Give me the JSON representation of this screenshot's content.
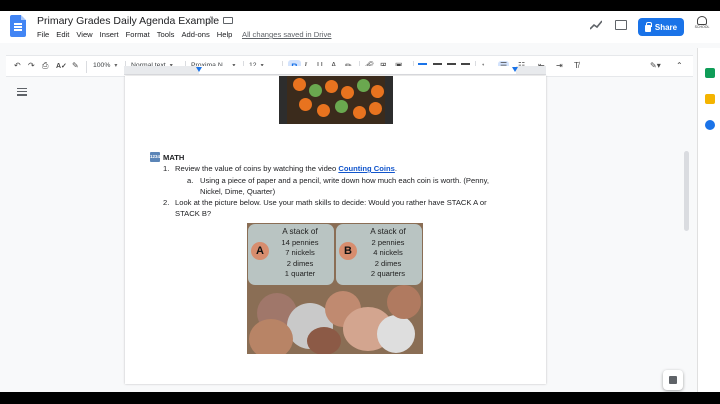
{
  "app": {
    "doc_title": "Primary Grades Daily Agenda Example",
    "save_status": "All changes saved in Drive",
    "menu": [
      "File",
      "Edit",
      "View",
      "Insert",
      "Format",
      "Tools",
      "Add-ons",
      "Help"
    ],
    "share_label": "Share",
    "avatar_text": "SCHOOL"
  },
  "toolbar": {
    "zoom": "100%",
    "style": "Normal text",
    "font": "Proxima N...",
    "font_size": "12"
  },
  "document": {
    "section_title": "MATH",
    "section_icon_text": "1234",
    "items": [
      {
        "number": "1.",
        "text_before": "Review the value of coins by watching the video ",
        "link": "Counting Coins",
        "text_after": "."
      },
      {
        "letter": "a.",
        "line1": "Using a piece of paper and a pencil, write down how much each coin is worth. (Penny,",
        "line2": "Nickel, Dime, Quarter)"
      },
      {
        "number": "2.",
        "line1": "Look at the picture below.  Use your math skills to decide: Would you rather have STACK A or",
        "line2": "STACK B?"
      }
    ],
    "stacks": [
      {
        "label": "A",
        "heading": "A stack of",
        "items": [
          "14 pennies",
          "7 nickels",
          "2 dimes",
          "1 quarter"
        ]
      },
      {
        "label": "B",
        "heading": "A stack of",
        "items": [
          "2 pennies",
          "4 nickels",
          "2 dimes",
          "2 quarters"
        ]
      }
    ]
  },
  "colors": {
    "share_blue": "#1a73e8",
    "link_blue": "#1155cc",
    "card_gray": "#b9c4c2",
    "letter_circle": "#d78d6e"
  }
}
